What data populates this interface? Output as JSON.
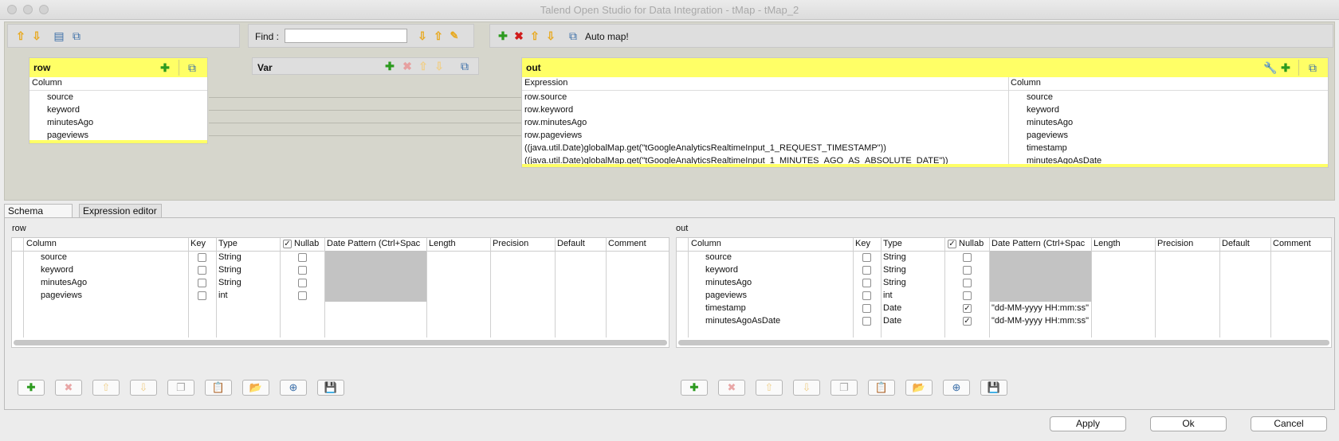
{
  "window": {
    "title": "Talend Open Studio for Data Integration - tMap - tMap_2"
  },
  "find": {
    "label": "Find :",
    "value": "",
    "placeholder": ""
  },
  "toolbar": {
    "automap_label": "Auto map!"
  },
  "input_table": {
    "name": "row",
    "column_header": "Column",
    "columns": [
      "source",
      "keyword",
      "minutesAgo",
      "pageviews"
    ]
  },
  "var_table": {
    "name": "Var"
  },
  "output_table": {
    "name": "out",
    "expression_header": "Expression",
    "column_header": "Column",
    "rows": [
      {
        "expression": "row.source",
        "column": "source"
      },
      {
        "expression": "row.keyword",
        "column": "keyword"
      },
      {
        "expression": "row.minutesAgo",
        "column": "minutesAgo"
      },
      {
        "expression": "row.pageviews",
        "column": "pageviews"
      },
      {
        "expression": "((java.util.Date)globalMap.get(\"tGoogleAnalyticsRealtimeInput_1_REQUEST_TIMESTAMP\"))",
        "column": "timestamp"
      },
      {
        "expression": "((java.util.Date)globalMap.get(\"tGoogleAnalyticsRealtimeInput_1_MINUTES_AGO_AS_ABSOLUTE_DATE\"))",
        "column": "minutesAgoAsDate"
      }
    ]
  },
  "tabs": [
    {
      "label": "Schema editor",
      "active": true
    },
    {
      "label": "Expression editor",
      "active": false
    }
  ],
  "schema_headers": [
    "Column",
    "Key",
    "Type",
    "Nullab",
    "Date Pattern (Ctrl+Spac",
    "Length",
    "Precision",
    "Default",
    "Comment"
  ],
  "schema_left": {
    "title": "row",
    "rows": [
      {
        "column": "source",
        "key": false,
        "type": "String",
        "nullable": false,
        "date_pattern": ""
      },
      {
        "column": "keyword",
        "key": false,
        "type": "String",
        "nullable": false,
        "date_pattern": ""
      },
      {
        "column": "minutesAgo",
        "key": false,
        "type": "String",
        "nullable": false,
        "date_pattern": ""
      },
      {
        "column": "pageviews",
        "key": false,
        "type": "int",
        "nullable": false,
        "date_pattern": ""
      }
    ]
  },
  "schema_right": {
    "title": "out",
    "rows": [
      {
        "column": "source",
        "key": false,
        "type": "String",
        "nullable": false,
        "date_pattern": ""
      },
      {
        "column": "keyword",
        "key": false,
        "type": "String",
        "nullable": false,
        "date_pattern": ""
      },
      {
        "column": "minutesAgo",
        "key": false,
        "type": "String",
        "nullable": false,
        "date_pattern": ""
      },
      {
        "column": "pageviews",
        "key": false,
        "type": "int",
        "nullable": false,
        "date_pattern": ""
      },
      {
        "column": "timestamp",
        "key": false,
        "type": "Date",
        "nullable": true,
        "date_pattern": "\"dd-MM-yyyy HH:mm:ss\""
      },
      {
        "column": "minutesAgoAsDate",
        "key": false,
        "type": "Date",
        "nullable": true,
        "date_pattern": "\"dd-MM-yyyy HH:mm:ss\""
      }
    ]
  },
  "buttons": {
    "apply": "Apply",
    "ok": "Ok",
    "cancel": "Cancel"
  },
  "colors": {
    "table_header": "#ffff66",
    "map_background": "#d6d6cc",
    "disabled_block": "#c3c3c3"
  }
}
